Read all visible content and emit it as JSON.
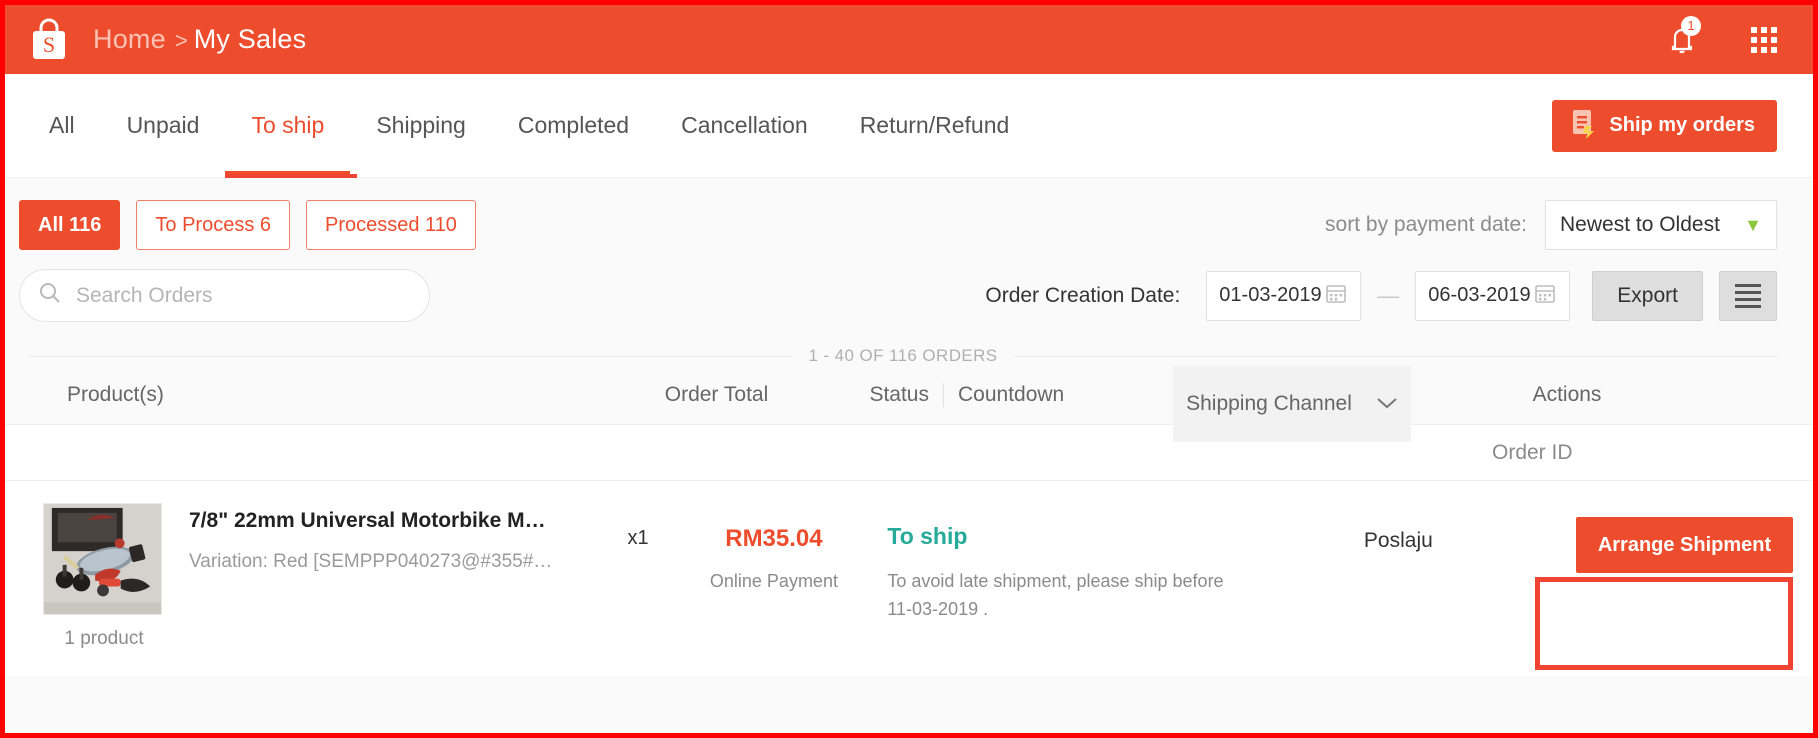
{
  "colors": {
    "brand_orange": "#ee4d2d",
    "annotation_red": "#ee4431",
    "status_teal": "#26aa99",
    "muted_gray": "#8b8b8b",
    "page_bg": "#fafafa"
  },
  "header": {
    "logo_letter": "S",
    "logo_name": "shopee-bag-logo",
    "breadcrumb": {
      "home": "Home",
      "separator": ">",
      "current": "My Sales"
    },
    "notification_badge": "1",
    "notification_icon": "bell-icon",
    "apps_icon": "apps-grid-icon"
  },
  "tabs": {
    "items": [
      {
        "label": "All",
        "active": false
      },
      {
        "label": "Unpaid",
        "active": false
      },
      {
        "label": "To ship",
        "active": true
      },
      {
        "label": "Shipping",
        "active": false
      },
      {
        "label": "Completed",
        "active": false
      },
      {
        "label": "Cancellation",
        "active": false
      },
      {
        "label": "Return/Refund",
        "active": false
      }
    ],
    "ship_my_orders_label": "Ship my orders",
    "ship_my_orders_icon": "document-lightning-icon"
  },
  "filters": {
    "chips": [
      {
        "label": "All 116",
        "style": "filled"
      },
      {
        "label": "To Process 6",
        "style": "outlined"
      },
      {
        "label": "Processed 110",
        "style": "outlined"
      }
    ],
    "sort_label": "sort by payment date:",
    "sort_value": "Newest to Oldest",
    "sort_chevron_icon": "chevron-down-icon"
  },
  "search": {
    "placeholder": "Search Orders",
    "value": "",
    "icon": "search-icon"
  },
  "date_range": {
    "label": "Order Creation Date:",
    "from": "01-03-2019",
    "to": "06-03-2019",
    "separator": "—",
    "calendar_icon": "calendar-icon"
  },
  "toolbar": {
    "export_label": "Export",
    "list_view_icon": "hamburger-list-icon"
  },
  "list_meta": {
    "count_text": "1 - 40 OF 116 ORDERS"
  },
  "table": {
    "headers": {
      "product": "Product(s)",
      "order_total": "Order Total",
      "status": "Status",
      "countdown": "Countdown",
      "shipping_channel": "Shipping Channel",
      "shipping_channel_chevron": "chevron-down-icon",
      "actions": "Actions"
    },
    "subheader": {
      "order_id": "Order ID"
    },
    "rows": [
      {
        "thumbnail_name": "motorbike-mirror-product-photo",
        "product_count": "1 product",
        "product_title": "7/8\" 22mm Universal Motorbike M…",
        "product_variation": "Variation: Red [SEMPPP040273@#355#…",
        "quantity": "x1",
        "order_total": "RM35.04",
        "payment_method": "Online Payment",
        "status": "To ship",
        "countdown_note": "To avoid late shipment, please ship before 11-03-2019 .",
        "shipping_channel": "Poslaju",
        "action_label": "Arrange Shipment"
      }
    ]
  }
}
